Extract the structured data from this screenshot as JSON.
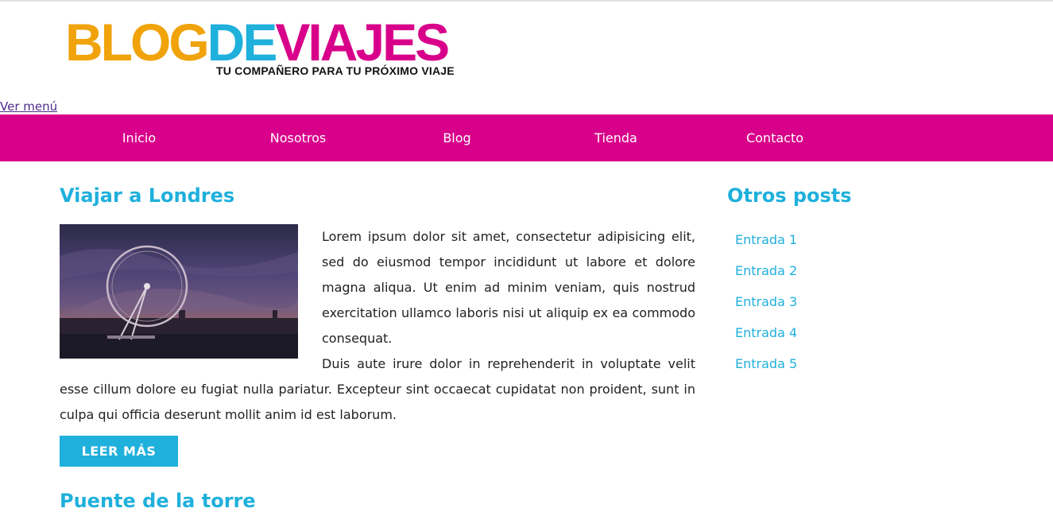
{
  "brand": {
    "logo_parts": [
      {
        "text": "BLOG",
        "color": "#f0a30a"
      },
      {
        "text": "DE",
        "color": "#1fb0dc"
      },
      {
        "text": "VIAJES",
        "color": "#d8008a"
      }
    ],
    "tagline": "TU COMPAÑERO PARA TU PRÓXIMO VIAJE"
  },
  "menu_toggle": "Ver menú",
  "nav": {
    "background": "#d8008a",
    "items": [
      "Inicio",
      "Nosotros",
      "Blog",
      "Tienda",
      "Contacto"
    ]
  },
  "post": {
    "title": "Viajar a Londres",
    "paragraph_1": "Lorem ipsum dolor sit amet, consectetur adipisicing elit, sed do eiusmod tempor incididunt ut labore et dolore magna aliqua. Ut enim ad minim veniam, quis nostrud exercitation ullamco laboris nisi ut aliquip ex ea commodo consequat.",
    "paragraph_2": "Duis aute irure dolor in reprehenderit in voluptate velit esse cillum dolore eu fugiat nulla pariatur. Excepteur sint occaecat cupidatat non proident, sunt in culpa qui officia deserunt mollit anim id est laborum.",
    "read_more": "LEER MÁS",
    "image_icon": "london-eye-photo"
  },
  "next_post": {
    "title": "Puente de la torre"
  },
  "sidebar": {
    "title": "Otros posts",
    "items": [
      "Entrada 1",
      "Entrada 2",
      "Entrada 3",
      "Entrada 4",
      "Entrada 5"
    ]
  },
  "colors": {
    "accent_blue": "#1fb0dc",
    "accent_magenta": "#d8008a",
    "accent_orange": "#f0a30a"
  }
}
